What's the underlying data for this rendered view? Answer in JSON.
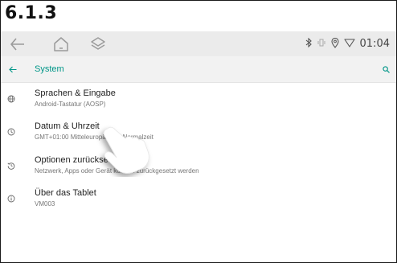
{
  "step_label": "6.1.3",
  "statusbar": {
    "time": "01:04",
    "icons": [
      "bluetooth-icon",
      "vibrate-icon",
      "location-icon",
      "wifi-icon"
    ]
  },
  "navbar": {
    "icons": [
      "back-arrow-icon",
      "home-icon",
      "layers-icon"
    ]
  },
  "appbar": {
    "title": "System",
    "accent_color": "#009688"
  },
  "settings_items": [
    {
      "icon": "globe-icon",
      "title": "Sprachen & Eingabe",
      "subtitle": "Android-Tastatur (AOSP)"
    },
    {
      "icon": "clock-icon",
      "title": "Datum & Uhrzeit",
      "subtitle": "GMT+01:00 Mitteleuropäische Normalzeit"
    },
    {
      "icon": "restore-icon",
      "title": "Optionen zurücksetzen",
      "subtitle": "Netzwerk, Apps oder Gerät können zurückgesetzt werden"
    },
    {
      "icon": "info-icon",
      "title": "Über das Tablet",
      "subtitle": "VM003"
    }
  ]
}
